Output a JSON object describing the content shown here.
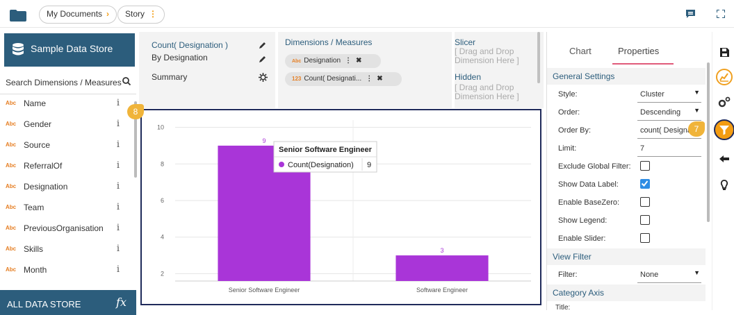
{
  "topbar": {
    "crumb_documents": "My Documents",
    "crumb_story": "Story",
    "arrow": "›",
    "kebab": "⋮",
    "accent": "#f39c12"
  },
  "left": {
    "store_title": "Sample Data Store",
    "search_placeholder": "Search Dimensions / Measures",
    "fields": [
      {
        "type": "Abc",
        "name": "Name"
      },
      {
        "type": "Abc",
        "name": "Gender"
      },
      {
        "type": "Abc",
        "name": "Source"
      },
      {
        "type": "Abc",
        "name": "ReferralOf"
      },
      {
        "type": "Abc",
        "name": "Designation"
      },
      {
        "type": "Abc",
        "name": "Team"
      },
      {
        "type": "Abc",
        "name": "PreviousOrganisation"
      },
      {
        "type": "Abc",
        "name": "Skills"
      },
      {
        "type": "Abc",
        "name": "Month"
      }
    ],
    "info_glyph": "i",
    "all_data_label": "ALL DATA STORE",
    "fx_label": "fx",
    "header_color": "#2c5d7c"
  },
  "config": {
    "measure_title": "Count( Designation )",
    "by_label": "By Designation",
    "summary_label": "Summary",
    "dim_title": "Dimensions / Measures",
    "pill1_type": "Abc",
    "pill1_label": "Designation",
    "pill2_type": "123",
    "pill2_label": "Count( Designati...",
    "slicer_title": "Slicer",
    "slicer_hint": "[ Drag and Drop Dimension Here ]",
    "hidden_title": "Hidden",
    "hidden_hint": "[ Drag and Drop Dimension Here ]"
  },
  "badges": {
    "chart": "8",
    "filter": "7"
  },
  "chart_data": {
    "type": "bar",
    "categories": [
      "Senior Software Engineer",
      "Software Engineer"
    ],
    "series": [
      {
        "name": "Count(Designation)",
        "values": [
          9,
          3
        ]
      }
    ],
    "ylim": [
      1.6,
      10.4
    ],
    "yticks": [
      2,
      4,
      6,
      8,
      10
    ],
    "data_labels": true,
    "bar_color": "#a935d8",
    "tooltip": {
      "title": "Senior Software Engineer",
      "label": "Count(Designation)",
      "value": "9"
    }
  },
  "props": {
    "tab_chart": "Chart",
    "tab_properties": "Properties",
    "section_general": "General Settings",
    "rows": [
      {
        "label": "Style:",
        "value": "Cluster",
        "kind": "select"
      },
      {
        "label": "Order:",
        "value": "Descending",
        "kind": "select"
      },
      {
        "label": "Order By:",
        "value": "count( Designa...",
        "kind": "text"
      },
      {
        "label": "Limit:",
        "value": "7",
        "kind": "text"
      },
      {
        "label": "Exclude Global Filter:",
        "checked": false,
        "kind": "check"
      },
      {
        "label": "Show Data Label:",
        "checked": true,
        "kind": "check"
      },
      {
        "label": "Enable BaseZero:",
        "checked": false,
        "kind": "check"
      },
      {
        "label": "Show Legend:",
        "checked": false,
        "kind": "check"
      },
      {
        "label": "Enable Slider:",
        "checked": false,
        "kind": "check"
      }
    ],
    "section_view_filter": "View Filter",
    "filter_label": "Filter:",
    "filter_value": "None",
    "section_category_axis": "Category Axis",
    "title_label": "Title:"
  },
  "icons": {
    "folder": "folder-icon",
    "database": "database-icon",
    "search": "search-icon",
    "save": "save-icon",
    "chart": "chart-icon",
    "settings": "gears-icon",
    "filter": "filter-icon",
    "back": "back-arrow-icon",
    "idea": "bulb-icon"
  }
}
